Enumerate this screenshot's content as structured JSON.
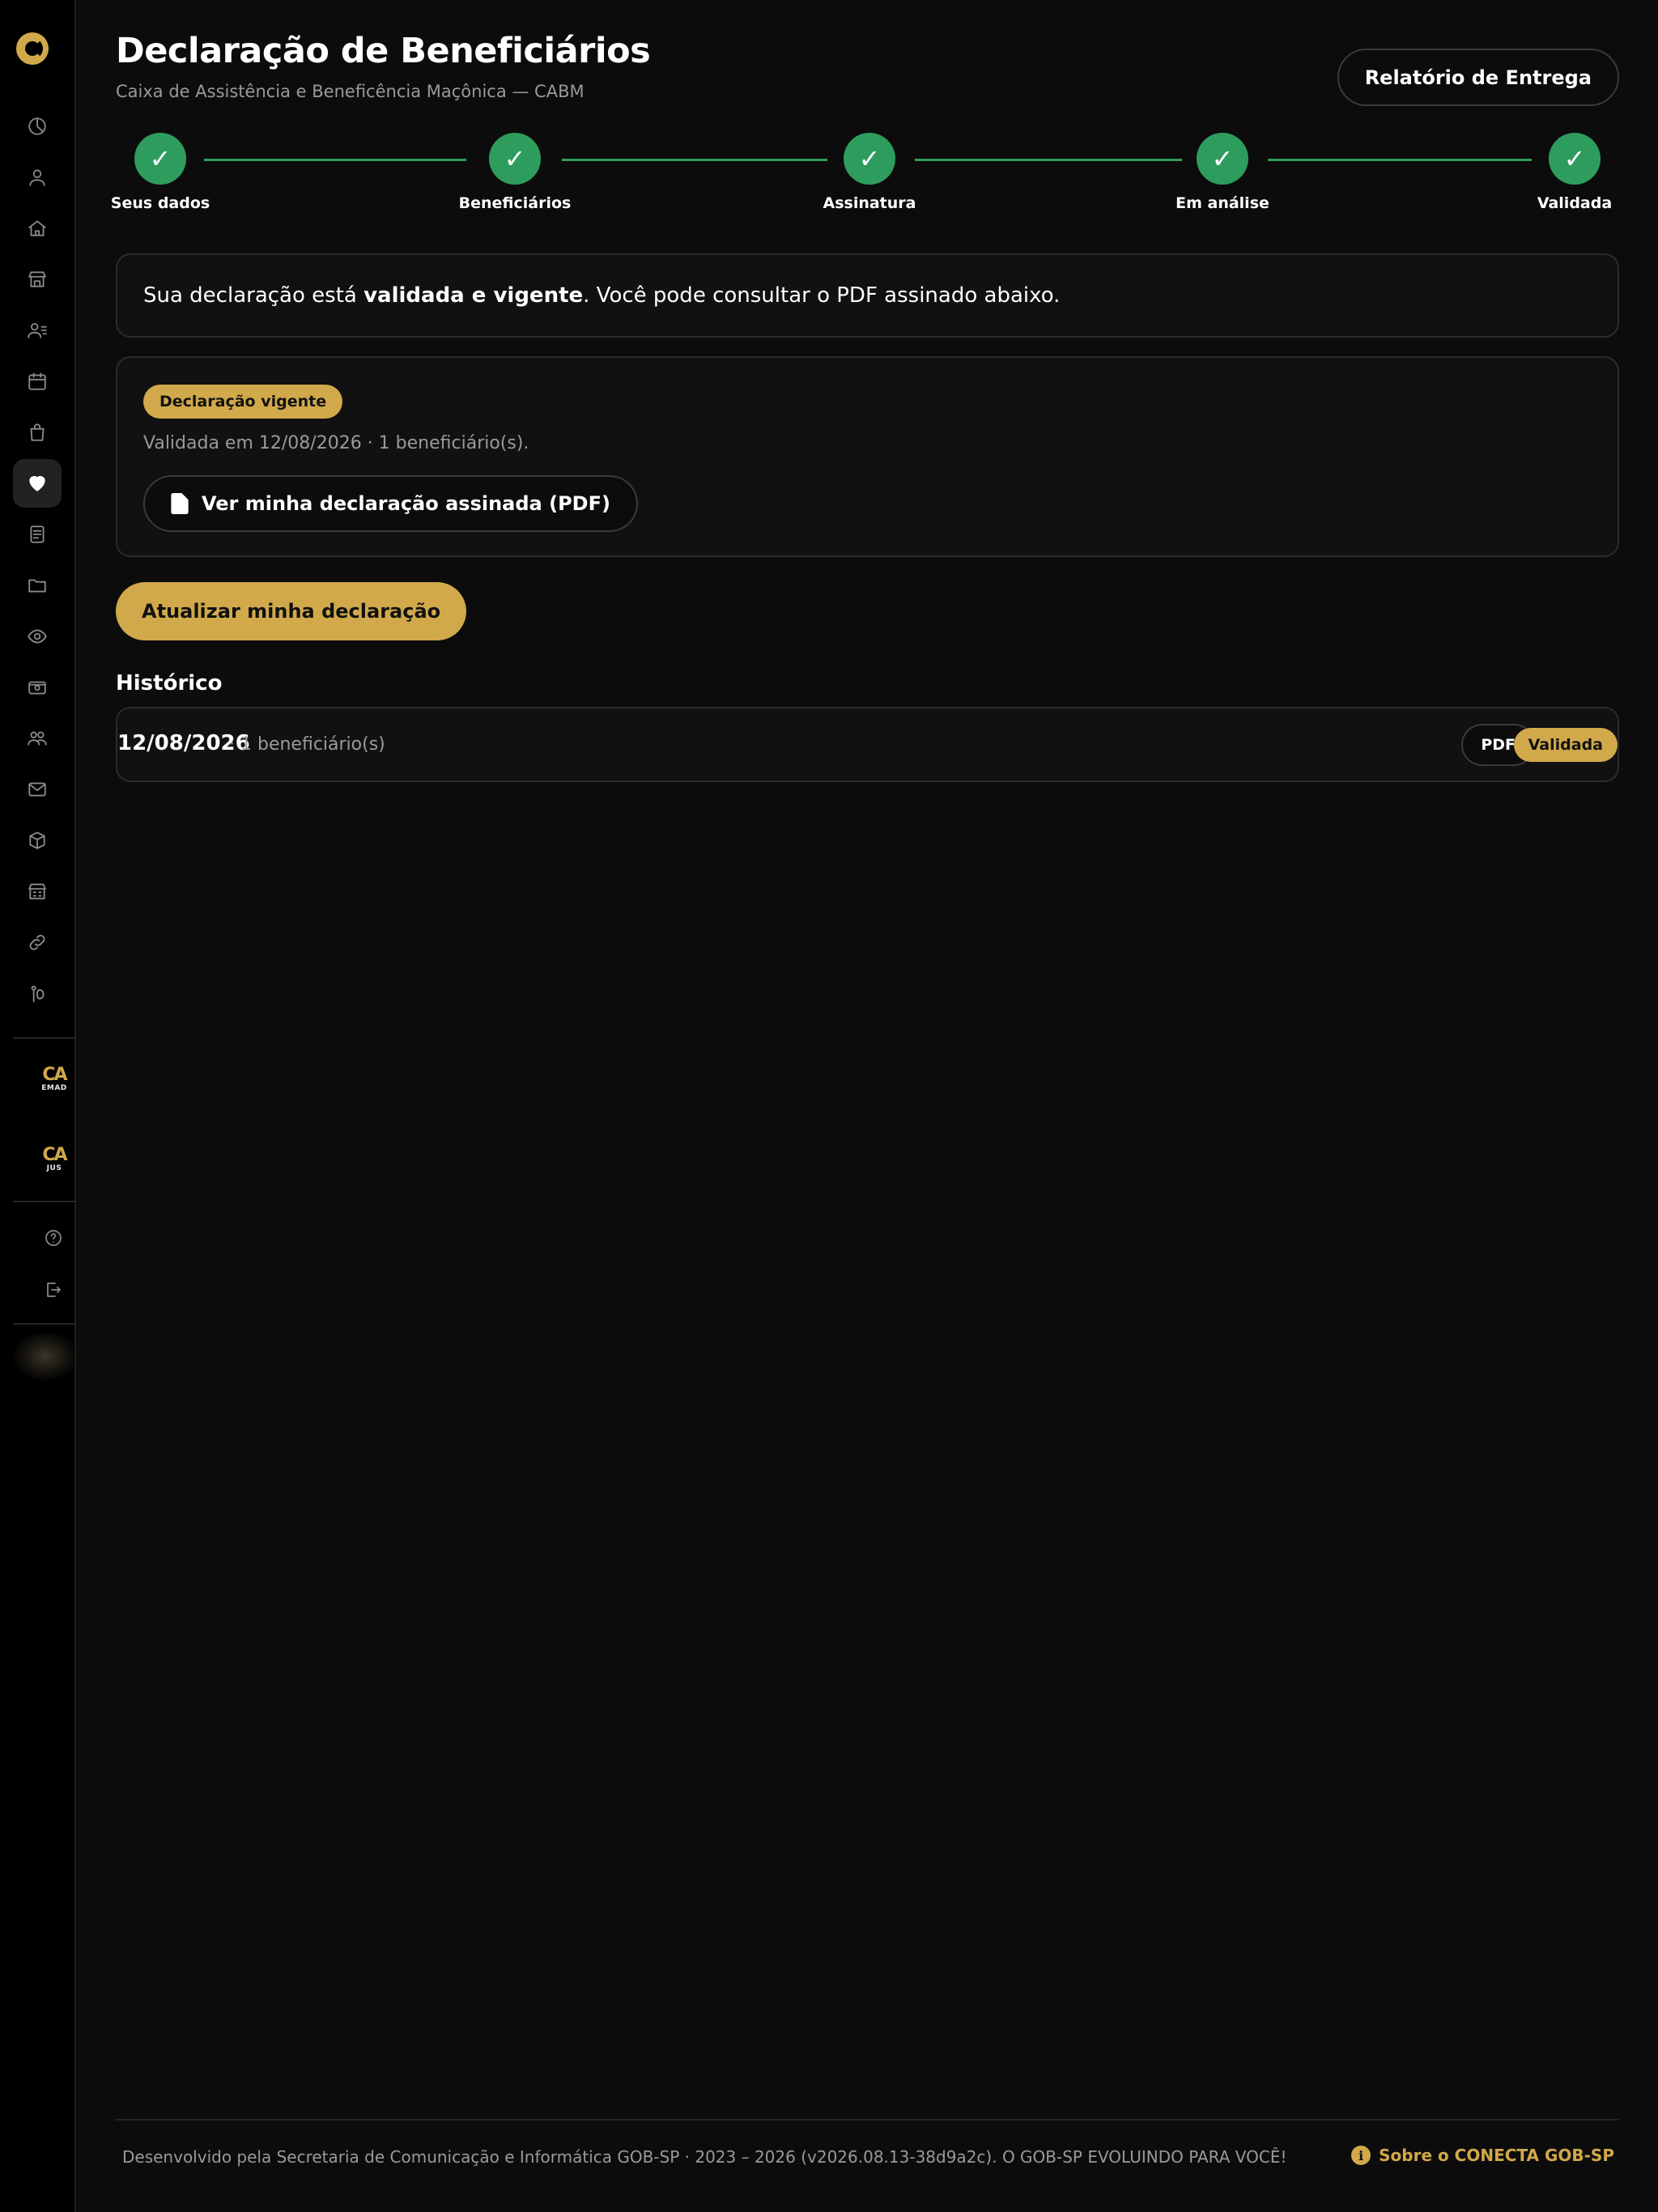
{
  "page": {
    "title": "Declaração de Beneficiários",
    "subtitle": "Caixa de Assistência e Beneficência Maçônica — CABM",
    "report_button": "Relatório de Entrega"
  },
  "stepper": {
    "steps": [
      {
        "label": "Seus dados",
        "status": "done"
      },
      {
        "label": "Beneficiários",
        "status": "done"
      },
      {
        "label": "Assinatura",
        "status": "done"
      },
      {
        "label": "Em análise",
        "status": "done"
      },
      {
        "label": "Validada",
        "status": "done"
      }
    ],
    "check_glyph": "✓"
  },
  "info": {
    "prefix": "Sua declaração está ",
    "bold": "validada e vigente",
    "suffix": ". Você pode consultar o PDF assinado abaixo."
  },
  "card": {
    "badge": "Declaração vigente",
    "meta": "Validada em 12/08/2026 · 1 beneficiário(s).",
    "pdf_button": "Ver minha declaração assinada (PDF)"
  },
  "update_button": "Atualizar minha declaração",
  "history": {
    "title": "Histórico",
    "rows": [
      {
        "date": "12/08/2026",
        "count": "· 1 beneficiário(s)",
        "pdf": "PDF",
        "status": "Validada"
      }
    ]
  },
  "sidebar": {
    "icons": [
      "dashboard-icon",
      "user-icon",
      "home-icon",
      "store-icon",
      "members-icon",
      "calendar-icon",
      "bag-icon",
      "heart-icon",
      "document-icon",
      "folder-icon",
      "eye-icon",
      "money-icon",
      "group-icon",
      "mail-icon",
      "box-icon",
      "building-icon",
      "link-icon",
      "contact-icon"
    ],
    "active": "heart-icon",
    "brands": [
      {
        "mark": "CA",
        "sub": "EMAD"
      },
      {
        "mark": "CA",
        "sub": "JUS"
      }
    ],
    "bottom_icons": [
      "help-icon",
      "logout-icon"
    ]
  },
  "footer": {
    "text": "Desenvolvido pela Secretaria de Comunicação e Informática GOB-SP · 2023 – 2026 (v2026.08.13-38d9a2c). O GOB-SP EVOLUINDO PARA VOCÊ!",
    "link": "Sobre o CONECTA GOB-SP",
    "info_glyph": "i"
  },
  "colors": {
    "accent_gold": "#d1a94a",
    "success_green": "#2e9c5c",
    "background": "#0c0c0c"
  }
}
